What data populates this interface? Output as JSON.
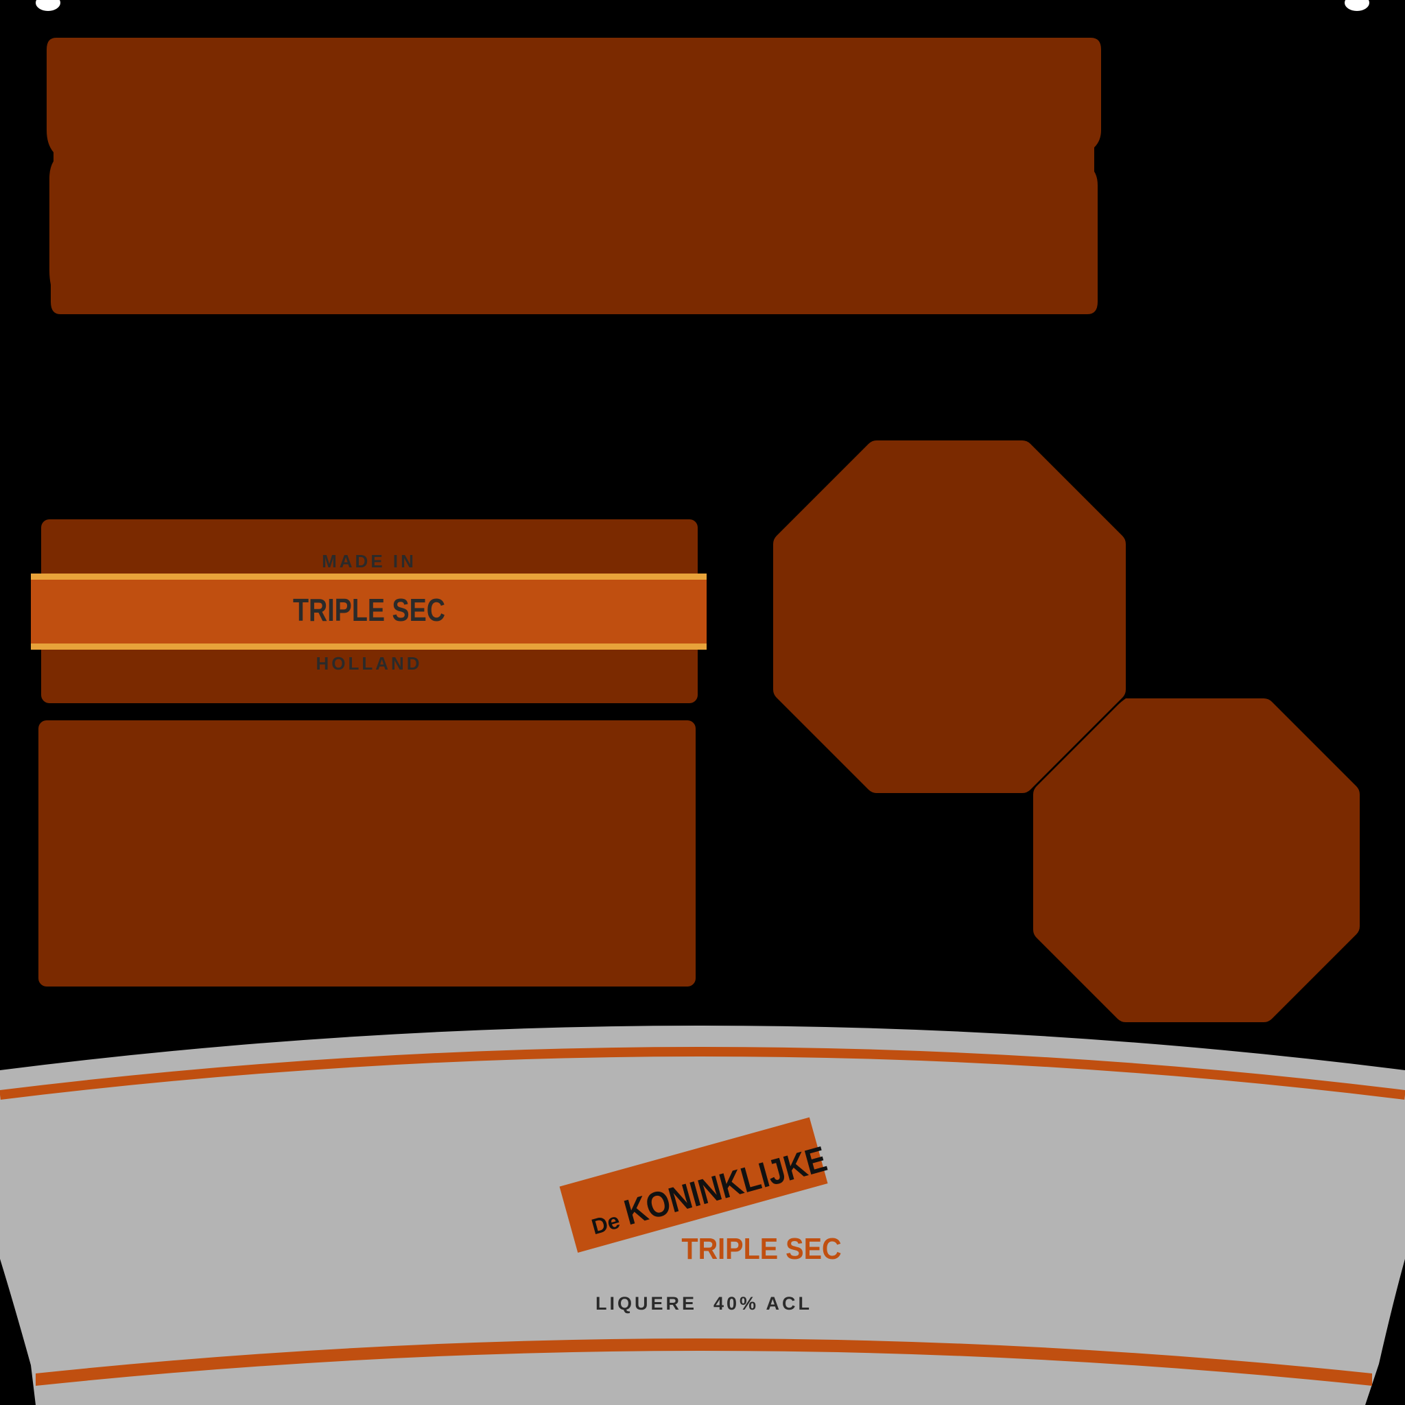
{
  "colors": {
    "background": "#000000",
    "panel_brown": "#7b2a00",
    "band_orange": "#c04f10",
    "band_gold": "#e8a33a",
    "label_gray": "#b4b4b4",
    "text_dark": "#2a2a2a",
    "text_black": "#111111"
  },
  "neck_label": {
    "top_text": "MADE IN",
    "band_text": "TRIPLE SEC",
    "bottom_text": "HOLLAND"
  },
  "main_label": {
    "brand_prefix": "De",
    "brand_name": "KONINKLIJKE",
    "product_name": "TRIPLE SEC",
    "category": "LIQUERE",
    "abv": "40% ACL"
  }
}
